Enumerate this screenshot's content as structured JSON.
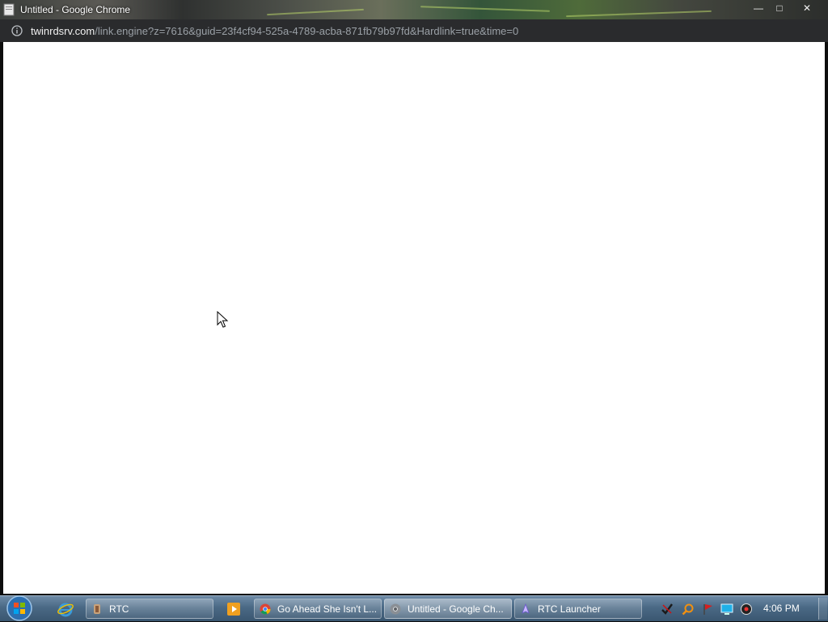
{
  "window": {
    "title": "Untitled - Google Chrome",
    "controls": {
      "minimize": "—",
      "maximize": "□",
      "close": "✕"
    }
  },
  "address_bar": {
    "host": "twinrdsrv.com",
    "path": "/link.engine?z=7616&guid=23f4cf94-525a-4789-acba-871fb79b97fd&Hardlink=true&time=0"
  },
  "taskbar": {
    "tasks": [
      {
        "label": "RTC",
        "icon": "rtc-app-icon"
      },
      {
        "label": "Go Ahead She Isn't L...",
        "icon": "chrome-icon"
      },
      {
        "label": "Untitled - Google Ch...",
        "icon": "chrome-gray-icon"
      },
      {
        "label": "RTC Launcher",
        "icon": "launcher-icon"
      }
    ],
    "clock": "4:06 PM"
  },
  "colors": {
    "urlbar_bg": "#2a2b2d",
    "taskbar_bg": "#4a6985",
    "page_bg": "#ffffff"
  }
}
